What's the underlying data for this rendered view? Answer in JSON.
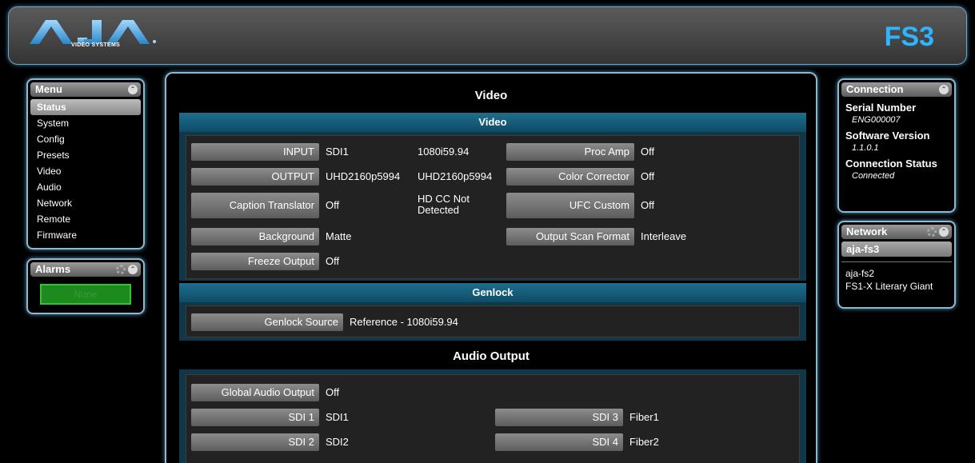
{
  "header": {
    "logo_text": "AJA",
    "logo_sub": "VIDEO SYSTEMS",
    "product": "FS3",
    "brand_color": "#2fb4ff"
  },
  "menu": {
    "title": "Menu",
    "items": [
      "Status",
      "System",
      "Config",
      "Presets",
      "Video",
      "Audio",
      "Network",
      "Remote",
      "Firmware"
    ],
    "active": "Status"
  },
  "alarms": {
    "title": "Alarms",
    "value": "None",
    "color": "#1d8a1d"
  },
  "connection": {
    "title": "Connection",
    "serial_label": "Serial Number",
    "serial_value": "ENG000007",
    "software_label": "Software Version",
    "software_value": "1.1.0.1",
    "status_label": "Connection Status",
    "status_value": "Connected"
  },
  "network": {
    "title": "Network",
    "selected": "aja-fs3",
    "items": [
      "aja-fs2",
      "FS1-X Literary Giant"
    ]
  },
  "main": {
    "title": "Video",
    "video_section": {
      "title": "Video",
      "input_label": "INPUT",
      "input_value": "SDI1",
      "input_format": "1080i59.94",
      "output_label": "OUTPUT",
      "output_value": "UHD2160p5994",
      "output_format": "UHD2160p5994",
      "caption_label": "Caption Translator",
      "caption_value": "Off",
      "caption_status": "HD CC Not Detected",
      "background_label": "Background",
      "background_value": "Matte",
      "freeze_label": "Freeze Output",
      "freeze_value": "Off",
      "procamp_label": "Proc Amp",
      "procamp_value": "Off",
      "colorcorr_label": "Color Corrector",
      "colorcorr_value": "Off",
      "ufc_label": "UFC Custom",
      "ufc_value": "Off",
      "scan_label": "Output Scan Format",
      "scan_value": "Interleave"
    },
    "genlock_section": {
      "title": "Genlock",
      "source_label": "Genlock Source",
      "source_value": "Reference - 1080i59.94"
    },
    "audio_title": "Audio Output",
    "audio_section": {
      "global_label": "Global Audio Output",
      "global_value": "Off",
      "sdi1_label": "SDI 1",
      "sdi1_value": "SDI1",
      "sdi2_label": "SDI 2",
      "sdi2_value": "SDI2",
      "sdi3_label": "SDI 3",
      "sdi3_value": "Fiber1",
      "sdi4_label": "SDI 4",
      "sdi4_value": "Fiber2"
    }
  }
}
